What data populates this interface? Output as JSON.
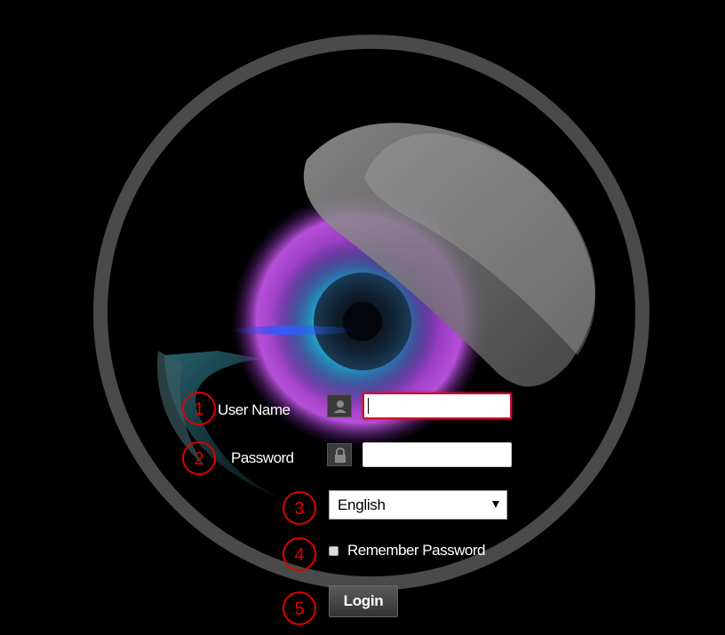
{
  "login_form": {
    "username_label": "User Name",
    "password_label": "Password",
    "username_value": "",
    "password_value": "",
    "language_selected": "English",
    "remember_label": "Remember Password",
    "login_label": "Login"
  },
  "annotations": [
    "1",
    "2",
    "3",
    "4",
    "5"
  ],
  "colors": {
    "background": "#000000",
    "focus_border": "#c8102e",
    "annotation": "#e00000",
    "ring": "#4a4a4a"
  },
  "icons": {
    "username": "user-icon",
    "password": "lock-icon"
  }
}
